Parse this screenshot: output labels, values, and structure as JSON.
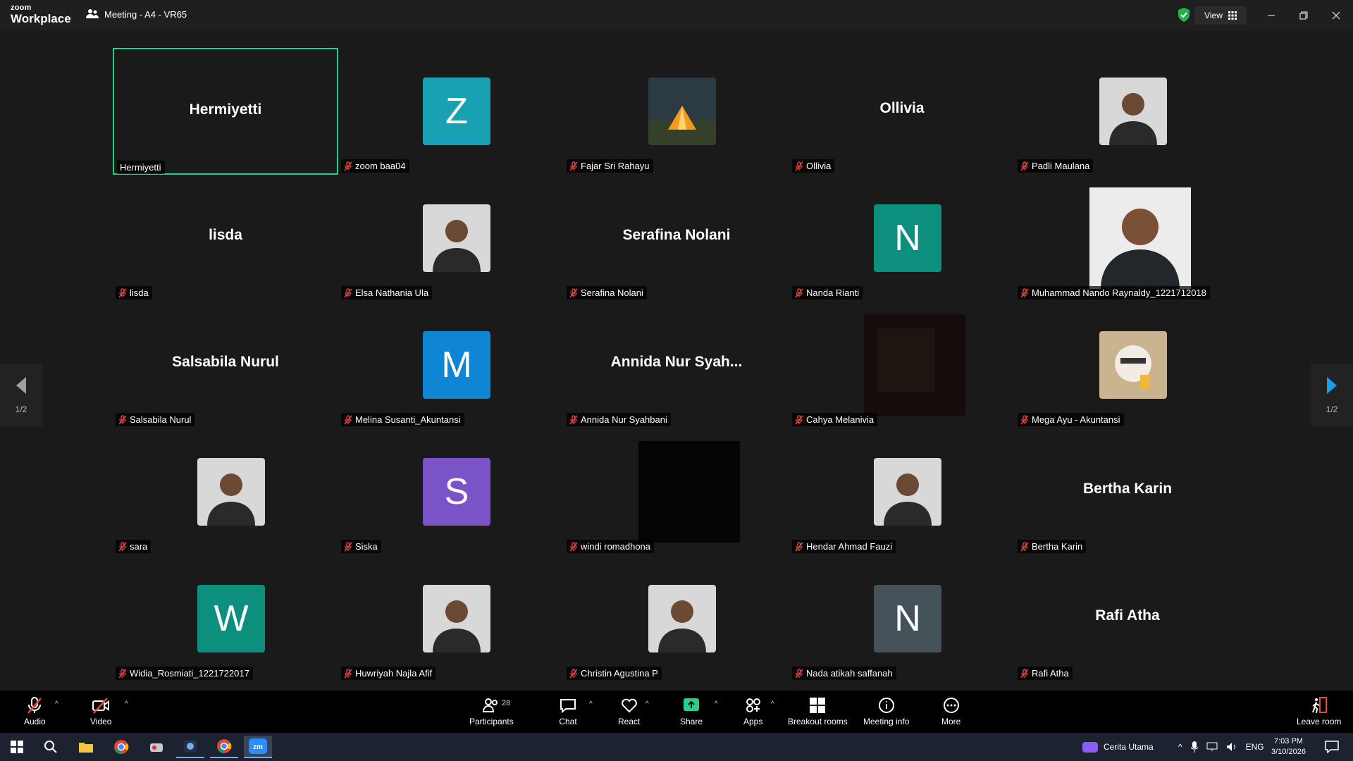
{
  "app": {
    "logo_line1": "zoom",
    "logo_line2": "Workplace",
    "meeting_title": "Meeting - A4 - VR65",
    "view_label": "View"
  },
  "colors": {
    "active_border": "#23d18b",
    "muted_mic": "#e8453c",
    "share_green": "#23d18b"
  },
  "nav": {
    "page_left": "1/2",
    "page_right": "1/2"
  },
  "tiles": [
    {
      "kind": "name",
      "big": "Hermiyetti",
      "label": "Hermiyetti",
      "active": true,
      "muted": false
    },
    {
      "kind": "letter",
      "letter": "Z",
      "bg": "#1aa0b3",
      "label": "zoom baa04",
      "muted": true
    },
    {
      "kind": "photo",
      "icon": "tent-photo",
      "label": "Fajar Sri Rahayu",
      "muted": true
    },
    {
      "kind": "name",
      "big": "Ollivia",
      "label": "Ollivia",
      "muted": true
    },
    {
      "kind": "photo",
      "icon": "person-photo",
      "label": "Padli Maulana",
      "muted": true
    },
    {
      "kind": "name",
      "big": "lisda",
      "label": "lisda",
      "muted": true
    },
    {
      "kind": "photo",
      "icon": "person-photo",
      "label": "Elsa Nathania Ula",
      "muted": true
    },
    {
      "kind": "name",
      "big": "Serafina Nolani",
      "label": "Serafina Nolani",
      "muted": true
    },
    {
      "kind": "letter",
      "letter": "N",
      "bg": "#0d8f7e",
      "label": "Nanda Rianti",
      "muted": true
    },
    {
      "kind": "video",
      "icon": "person-video",
      "label": "Muhammad Nando Raynaldy_1221712018",
      "muted": true
    },
    {
      "kind": "name",
      "big": "Salsabila Nurul",
      "label": "Salsabila Nurul",
      "muted": true
    },
    {
      "kind": "letter",
      "letter": "M",
      "bg": "#0e86d4",
      "label": "Melina Susanti_Akuntansi",
      "muted": true
    },
    {
      "kind": "name",
      "big": "Annida  Nur  Syah...",
      "label": "Annida Nur Syahbani",
      "muted": true
    },
    {
      "kind": "video",
      "icon": "dark-video",
      "label": "Cahya Melanivia",
      "muted": true
    },
    {
      "kind": "photo",
      "icon": "cat-photo",
      "label": "Mega Ayu - Akuntansi",
      "muted": true
    },
    {
      "kind": "photo",
      "icon": "person-photo",
      "label": "sara",
      "muted": true
    },
    {
      "kind": "letter",
      "letter": "S",
      "bg": "#7a53c9",
      "label": "Siska",
      "muted": true
    },
    {
      "kind": "video",
      "icon": "black-video",
      "label": "windi romadhona",
      "muted": true
    },
    {
      "kind": "photo",
      "icon": "person-photo",
      "label": "Hendar Ahmad Fauzi",
      "muted": true
    },
    {
      "kind": "name",
      "big": "Bertha Karin",
      "label": "Bertha Karin",
      "muted": true
    },
    {
      "kind": "letter",
      "letter": "W",
      "bg": "#0d8f7e",
      "label": "Widia_Rosmiati_1221722017",
      "muted": true
    },
    {
      "kind": "photo",
      "icon": "person-photo",
      "label": "Huwriyah Najla Afif",
      "muted": true
    },
    {
      "kind": "photo",
      "icon": "person-photo",
      "label": "Christin Agustina P",
      "muted": true
    },
    {
      "kind": "letter",
      "letter": "N",
      "bg": "#45525a",
      "label": "Nada atikah saffanah",
      "muted": true
    },
    {
      "kind": "name",
      "big": "Rafi Atha",
      "label": "Rafi Atha",
      "muted": true
    }
  ],
  "toolbar": {
    "audio": "Audio",
    "video": "Video",
    "participants": "Participants",
    "participants_count": "28",
    "chat": "Chat",
    "react": "React",
    "share": "Share",
    "apps": "Apps",
    "breakout": "Breakout rooms",
    "info": "Meeting info",
    "more": "More",
    "leave": "Leave room"
  },
  "taskbar": {
    "app_name": "Cerita Utama",
    "lang": "ENG",
    "time": "7:03 PM",
    "date": "3/10/2026"
  }
}
